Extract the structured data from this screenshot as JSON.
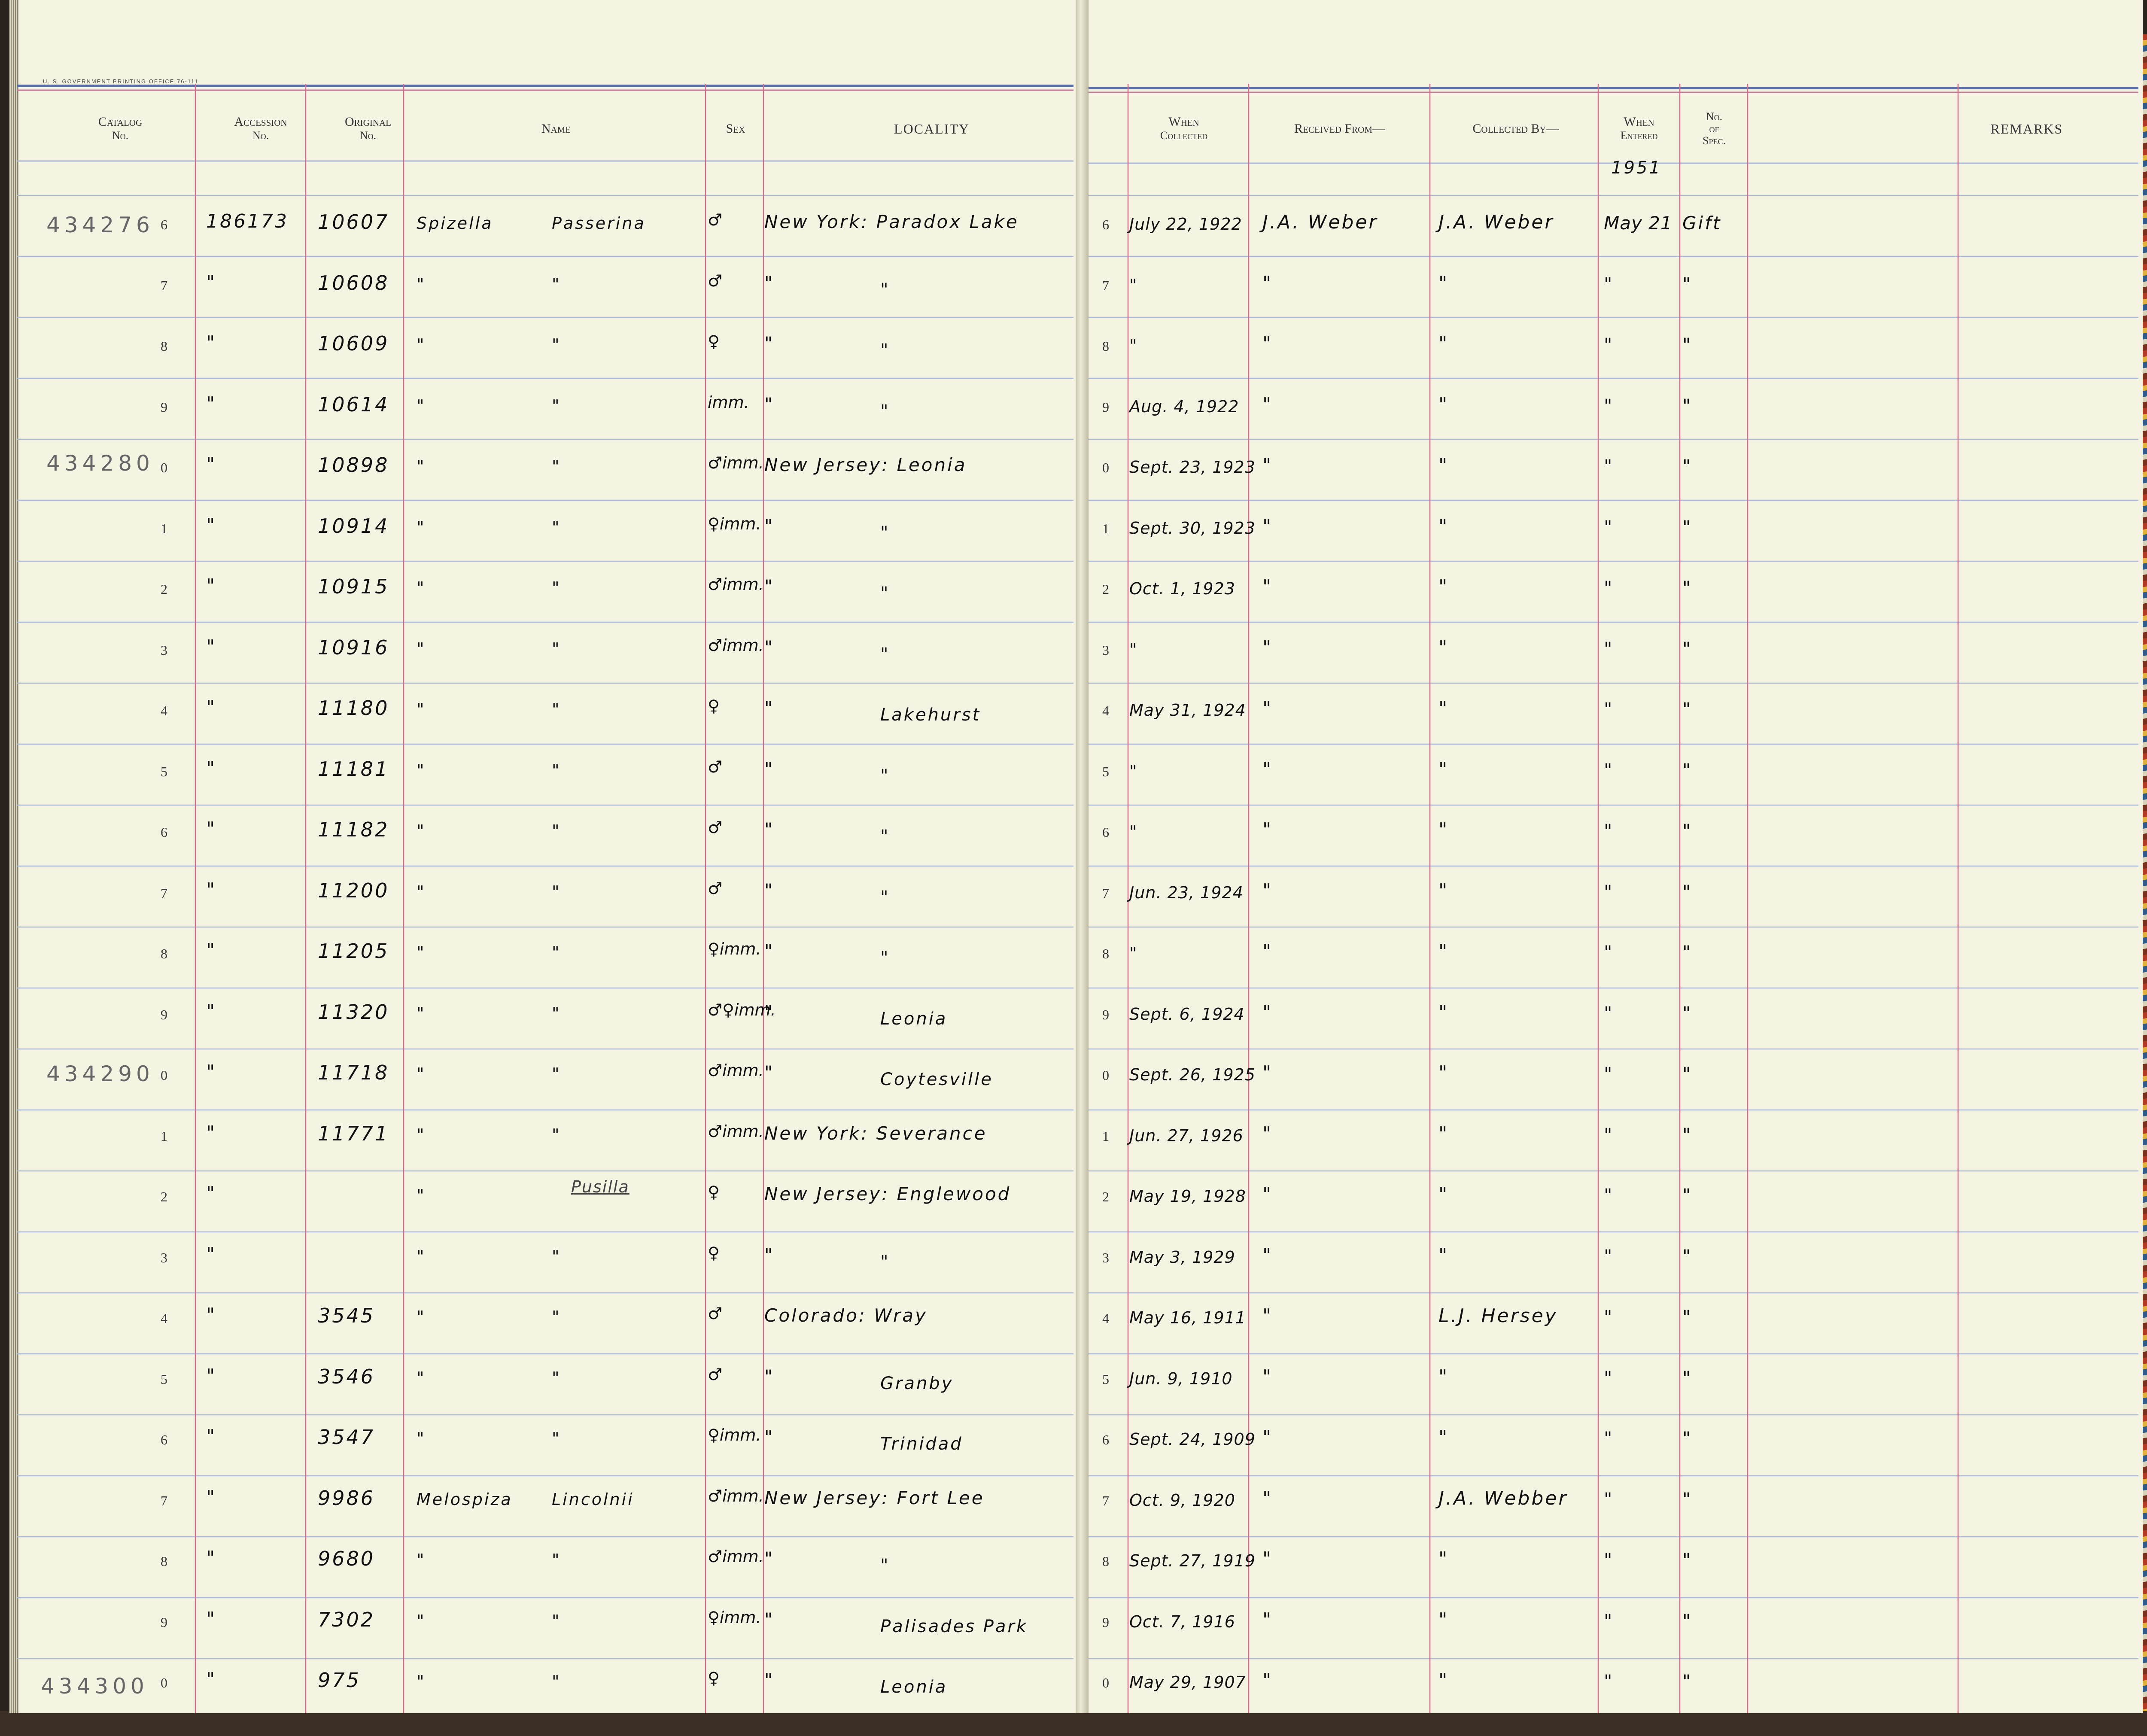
{
  "print_note": "U. S. GOVERNMENT PRINTING OFFICE   76-111",
  "headers": {
    "catalog": [
      "Catalog",
      "No."
    ],
    "accession": [
      "Accession",
      "No."
    ],
    "original": [
      "Original",
      "No."
    ],
    "name": "Name",
    "sex": "Sex",
    "locality": "LOCALITY",
    "when_collected": [
      "When",
      "Collected"
    ],
    "received_from": "Received From—",
    "collected_by": "Collected By—",
    "when_entered": [
      "When",
      "Entered"
    ],
    "no_spec": [
      "No.",
      "of",
      "Spec."
    ],
    "remarks": "REMARKS"
  },
  "year_entered": "1951",
  "catalog_prefixes": [
    "434276",
    "434280",
    "434290",
    "434300"
  ],
  "rows": [
    {
      "n": "6",
      "acc": "186173",
      "orig": "10607",
      "genus": "Spizella",
      "species": "Passerina",
      "sex": "♂",
      "loc1": "New York: Paradox Lake",
      "loc2": "",
      "ln": "6",
      "date": "July 22, 1922",
      "recv": "J.A. Weber",
      "coll": "J.A. Weber",
      "entered": "May 21",
      "spec": "Gift"
    },
    {
      "n": "7",
      "acc": "\"",
      "orig": "10608",
      "genus": "\"",
      "species": "\"",
      "sex": "♂",
      "loc1": "\"",
      "loc2": "\"",
      "ln": "7",
      "date": "\"",
      "recv": "\"",
      "coll": "\"",
      "entered": "\"",
      "spec": "\""
    },
    {
      "n": "8",
      "acc": "\"",
      "orig": "10609",
      "genus": "\"",
      "species": "\"",
      "sex": "♀",
      "loc1": "\"",
      "loc2": "\"",
      "ln": "8",
      "date": "\"",
      "recv": "\"",
      "coll": "\"",
      "entered": "\"",
      "spec": "\""
    },
    {
      "n": "9",
      "acc": "\"",
      "orig": "10614",
      "genus": "\"",
      "species": "\"",
      "sex": "imm.",
      "loc1": "\"",
      "loc2": "\"",
      "ln": "9",
      "date": "Aug. 4, 1922",
      "recv": "\"",
      "coll": "\"",
      "entered": "\"",
      "spec": "\""
    },
    {
      "n": "0",
      "acc": "\"",
      "orig": "10898",
      "genus": "\"",
      "species": "\"",
      "sex": "♂imm.",
      "loc1": "New Jersey: Leonia",
      "loc2": "",
      "ln": "0",
      "date": "Sept. 23, 1923",
      "recv": "\"",
      "coll": "\"",
      "entered": "\"",
      "spec": "\""
    },
    {
      "n": "1",
      "acc": "\"",
      "orig": "10914",
      "genus": "\"",
      "species": "\"",
      "sex": "♀imm.",
      "loc1": "\"",
      "loc2": "\"",
      "ln": "1",
      "date": "Sept. 30, 1923",
      "recv": "\"",
      "coll": "\"",
      "entered": "\"",
      "spec": "\""
    },
    {
      "n": "2",
      "acc": "\"",
      "orig": "10915",
      "genus": "\"",
      "species": "\"",
      "sex": "♂imm.",
      "loc1": "\"",
      "loc2": "\"",
      "ln": "2",
      "date": "Oct. 1, 1923",
      "recv": "\"",
      "coll": "\"",
      "entered": "\"",
      "spec": "\""
    },
    {
      "n": "3",
      "acc": "\"",
      "orig": "10916",
      "genus": "\"",
      "species": "\"",
      "sex": "♂imm.",
      "loc1": "\"",
      "loc2": "\"",
      "ln": "3",
      "date": "\"",
      "recv": "\"",
      "coll": "\"",
      "entered": "\"",
      "spec": "\""
    },
    {
      "n": "4",
      "acc": "\"",
      "orig": "11180",
      "genus": "\"",
      "species": "\"",
      "sex": "♀",
      "loc1": "\"",
      "loc2": "Lakehurst",
      "ln": "4",
      "date": "May 31, 1924",
      "recv": "\"",
      "coll": "\"",
      "entered": "\"",
      "spec": "\""
    },
    {
      "n": "5",
      "acc": "\"",
      "orig": "11181",
      "genus": "\"",
      "species": "\"",
      "sex": "♂",
      "loc1": "\"",
      "loc2": "\"",
      "ln": "5",
      "date": "\"",
      "recv": "\"",
      "coll": "\"",
      "entered": "\"",
      "spec": "\""
    },
    {
      "n": "6",
      "acc": "\"",
      "orig": "11182",
      "genus": "\"",
      "species": "\"",
      "sex": "♂",
      "loc1": "\"",
      "loc2": "\"",
      "ln": "6",
      "date": "\"",
      "recv": "\"",
      "coll": "\"",
      "entered": "\"",
      "spec": "\""
    },
    {
      "n": "7",
      "acc": "\"",
      "orig": "11200",
      "genus": "\"",
      "species": "\"",
      "sex": "♂",
      "loc1": "\"",
      "loc2": "\"",
      "ln": "7",
      "date": "Jun. 23, 1924",
      "recv": "\"",
      "coll": "\"",
      "entered": "\"",
      "spec": "\""
    },
    {
      "n": "8",
      "acc": "\"",
      "orig": "11205",
      "genus": "\"",
      "species": "\"",
      "sex": "♀imm.",
      "loc1": "\"",
      "loc2": "\"",
      "ln": "8",
      "date": "\"",
      "recv": "\"",
      "coll": "\"",
      "entered": "\"",
      "spec": "\""
    },
    {
      "n": "9",
      "acc": "\"",
      "orig": "11320",
      "genus": "\"",
      "species": "\"",
      "sex": "♂♀imm.",
      "loc1": "\"",
      "loc2": "Leonia",
      "ln": "9",
      "date": "Sept. 6, 1924",
      "recv": "\"",
      "coll": "\"",
      "entered": "\"",
      "spec": "\""
    },
    {
      "n": "0",
      "acc": "\"",
      "orig": "11718",
      "genus": "\"",
      "species": "\"",
      "sex": "♂imm.",
      "loc1": "\"",
      "loc2": "Coytesville",
      "ln": "0",
      "date": "Sept. 26, 1925",
      "recv": "\"",
      "coll": "\"",
      "entered": "\"",
      "spec": "\""
    },
    {
      "n": "1",
      "acc": "\"",
      "orig": "11771",
      "genus": "\"",
      "species": "\"",
      "sex": "♂imm.",
      "loc1": "New York: Severance",
      "loc2": "",
      "ln": "1",
      "date": "Jun. 27, 1926",
      "recv": "\"",
      "coll": "\"",
      "entered": "\"",
      "spec": "\""
    },
    {
      "n": "2",
      "acc": "\"",
      "orig": "",
      "genus": "\"",
      "species": "Pusilla",
      "sex": "♀",
      "loc1": "New Jersey: Englewood",
      "loc2": "",
      "ln": "2",
      "date": "May 19, 1928",
      "recv": "\"",
      "coll": "\"",
      "entered": "\"",
      "spec": "\""
    },
    {
      "n": "3",
      "acc": "\"",
      "orig": "",
      "genus": "\"",
      "species": "\"",
      "sex": "♀",
      "loc1": "\"",
      "loc2": "\"",
      "ln": "3",
      "date": "May 3, 1929",
      "recv": "\"",
      "coll": "\"",
      "entered": "\"",
      "spec": "\""
    },
    {
      "n": "4",
      "acc": "\"",
      "orig": "3545",
      "genus": "\"",
      "species": "\"",
      "sex": "♂",
      "loc1": "Colorado: Wray",
      "loc2": "",
      "ln": "4",
      "date": "May 16, 1911",
      "recv": "\"",
      "coll": "L.J. Hersey",
      "entered": "\"",
      "spec": "\""
    },
    {
      "n": "5",
      "acc": "\"",
      "orig": "3546",
      "genus": "\"",
      "species": "\"",
      "sex": "♂",
      "loc1": "\"",
      "loc2": "Granby",
      "ln": "5",
      "date": "Jun. 9, 1910",
      "recv": "\"",
      "coll": "\"",
      "entered": "\"",
      "spec": "\""
    },
    {
      "n": "6",
      "acc": "\"",
      "orig": "3547",
      "genus": "\"",
      "species": "\"",
      "sex": "♀imm.",
      "loc1": "\"",
      "loc2": "Trinidad",
      "ln": "6",
      "date": "Sept. 24, 1909",
      "recv": "\"",
      "coll": "\"",
      "entered": "\"",
      "spec": "\""
    },
    {
      "n": "7",
      "acc": "\"",
      "orig": "9986",
      "genus": "Melospiza",
      "species": "Lincolnii",
      "sex": "♂imm.",
      "loc1": "New Jersey: Fort Lee",
      "loc2": "",
      "ln": "7",
      "date": "Oct. 9, 1920",
      "recv": "\"",
      "coll": "J.A. Webber",
      "entered": "\"",
      "spec": "\""
    },
    {
      "n": "8",
      "acc": "\"",
      "orig": "9680",
      "genus": "\"",
      "species": "\"",
      "sex": "♂imm.",
      "loc1": "\"",
      "loc2": "\"",
      "ln": "8",
      "date": "Sept. 27, 1919",
      "recv": "\"",
      "coll": "\"",
      "entered": "\"",
      "spec": "\""
    },
    {
      "n": "9",
      "acc": "\"",
      "orig": "7302",
      "genus": "\"",
      "species": "\"",
      "sex": "♀imm.",
      "loc1": "\"",
      "loc2": "Palisades Park",
      "ln": "9",
      "date": "Oct. 7, 1916",
      "recv": "\"",
      "coll": "\"",
      "entered": "\"",
      "spec": "\""
    },
    {
      "n": "0",
      "acc": "\"",
      "orig": "975",
      "genus": "\"",
      "species": "\"",
      "sex": "♀",
      "loc1": "\"",
      "loc2": "Leonia",
      "ln": "0",
      "date": "May 29, 1907",
      "recv": "\"",
      "coll": "\"",
      "entered": "\"",
      "spec": "\""
    }
  ]
}
